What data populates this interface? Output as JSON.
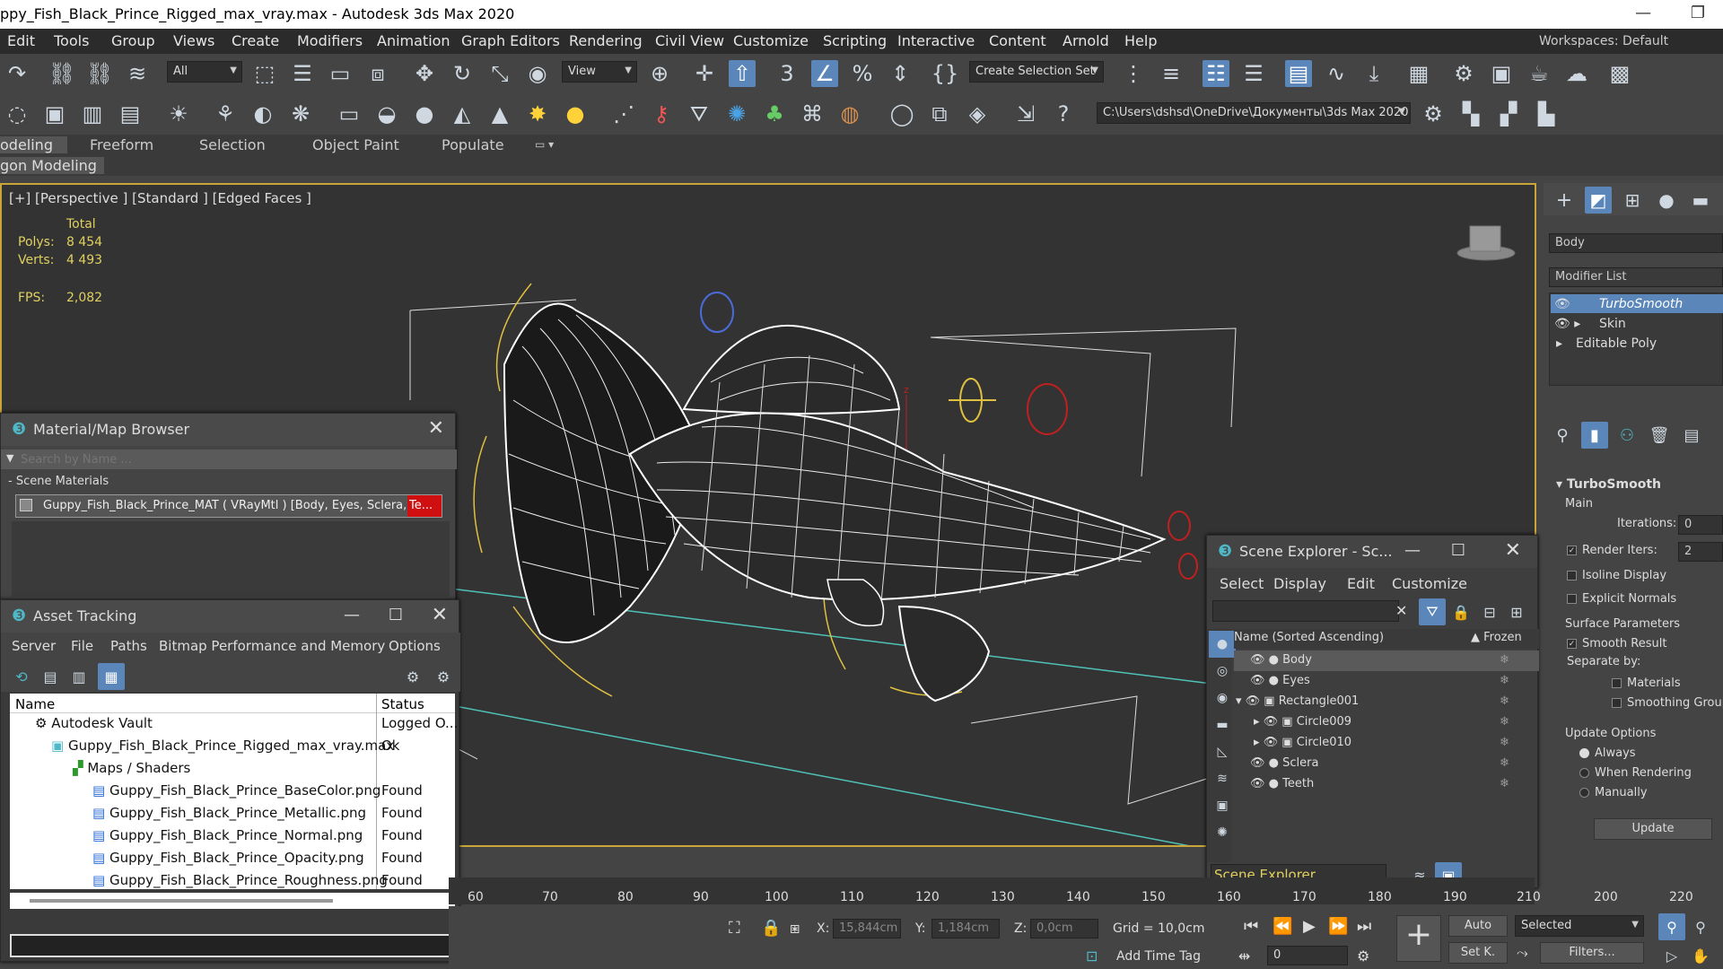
{
  "window": {
    "title": "ppy_Fish_Black_Prince_Rigged_max_vray.max - Autodesk 3ds Max 2020",
    "minimize": "—",
    "restore": "❐"
  },
  "menu": [
    "Edit",
    "Tools",
    "Group",
    "Views",
    "Create",
    "Modifiers",
    "Animation",
    "Graph Editors",
    "Rendering",
    "Civil View",
    "Customize",
    "Scripting",
    "Interactive",
    "Content",
    "Arnold",
    "Help"
  ],
  "workspaces": {
    "label": "Workspaces:",
    "value": "Default"
  },
  "toolbar": {
    "filter_value": "All",
    "refcoord_value": "View",
    "selection_set": "Create Selection Set",
    "path": "C:\\Users\\dshsd\\OneDrive\\Документы\\3ds Max 2020"
  },
  "ribbon": {
    "tabs": [
      "odeling",
      "Freeform",
      "Selection",
      "Object Paint",
      "Populate"
    ],
    "subtab": "gon Modeling"
  },
  "viewport": {
    "label": "[+] [Perspective ] [Standard ] [Edged Faces ]",
    "stats": {
      "total_label": "Total",
      "polys_label": "Polys:",
      "polys_value": "8 454",
      "verts_label": "Verts:",
      "verts_value": "4 493",
      "fps_label": "FPS:",
      "fps_value": "2,082"
    },
    "gizmo_axis": "z"
  },
  "command_panel": {
    "object_name": "Body",
    "modifier_list": "Modifier List",
    "stack": [
      "TurboSmooth",
      "Skin",
      "Editable Poly"
    ],
    "rollout_title": "TurboSmooth",
    "main_label": "Main",
    "iterations_label": "Iterations:",
    "iterations_value": "0",
    "render_iters_label": "Render Iters:",
    "render_iters_value": "2",
    "isoline": "Isoline Display",
    "explicit_normals": "Explicit Normals",
    "surface_params": "Surface Parameters",
    "smooth_result": "Smooth Result",
    "separate_by": "Separate by:",
    "materials": "Materials",
    "smoothing_groups": "Smoothing Groups",
    "update_options": "Update Options",
    "always": "Always",
    "when_rendering": "When Rendering",
    "manually": "Manually",
    "update_btn": "Update"
  },
  "material_browser": {
    "title": "Material/Map Browser",
    "search_placeholder": "Search by Name ...",
    "section": "- Scene Materials",
    "item": "Guppy_Fish_Black_Prince_MAT  ( VRayMtl )  [Body, Eyes, Sclera, ",
    "item_tail": "Te..."
  },
  "asset_tracking": {
    "title": "Asset Tracking",
    "menu": [
      "Server",
      "File",
      "Paths",
      "Bitmap Performance and Memory",
      "Options"
    ],
    "col_name": "Name",
    "col_status": "Status",
    "rows": [
      {
        "name": "Autodesk Vault",
        "status": "Logged O..."
      },
      {
        "name": "Guppy_Fish_Black_Prince_Rigged_max_vray.max",
        "status": "Ok"
      },
      {
        "name": "Maps / Shaders",
        "status": ""
      },
      {
        "name": "Guppy_Fish_Black_Prince_BaseColor.png",
        "status": "Found"
      },
      {
        "name": "Guppy_Fish_Black_Prince_Metallic.png",
        "status": "Found"
      },
      {
        "name": "Guppy_Fish_Black_Prince_Normal.png",
        "status": "Found"
      },
      {
        "name": "Guppy_Fish_Black_Prince_Opacity.png",
        "status": "Found"
      },
      {
        "name": "Guppy_Fish_Black_Prince_Roughness.png",
        "status": "Found"
      }
    ]
  },
  "scene_explorer": {
    "title": "Scene Explorer - Sc...",
    "menu": [
      "Select",
      "Display",
      "Edit",
      "Customize"
    ],
    "col_name": "Name (Sorted Ascending)",
    "col_frozen": "▲ Frozen",
    "items": [
      "Body",
      "Eyes",
      "Rectangle001",
      "Circle009",
      "Circle010",
      "Sclera",
      "Teeth"
    ],
    "footer": "Scene Explorer"
  },
  "timeline": {
    "ticks": [
      "60",
      "70",
      "80",
      "90",
      "100",
      "110",
      "120",
      "130",
      "140",
      "150",
      "160",
      "170",
      "180",
      "190",
      "200",
      "210",
      "220"
    ]
  },
  "status": {
    "x_label": "X:",
    "x_value": "15,844cm",
    "y_label": "Y:",
    "y_value": "1,184cm",
    "z_label": "Z:",
    "z_value": "0,0cm",
    "grid": "Grid = 10,0cm",
    "add_time_tag": "Add Time Tag",
    "auto": "Auto",
    "selected": "Selected",
    "set_k": "Set K.",
    "filters": "Filters...",
    "frame": "0"
  },
  "colors": {
    "accent": "#5b86b9",
    "viewport_border": "#caa53a",
    "stats_text": "#e0d060"
  }
}
